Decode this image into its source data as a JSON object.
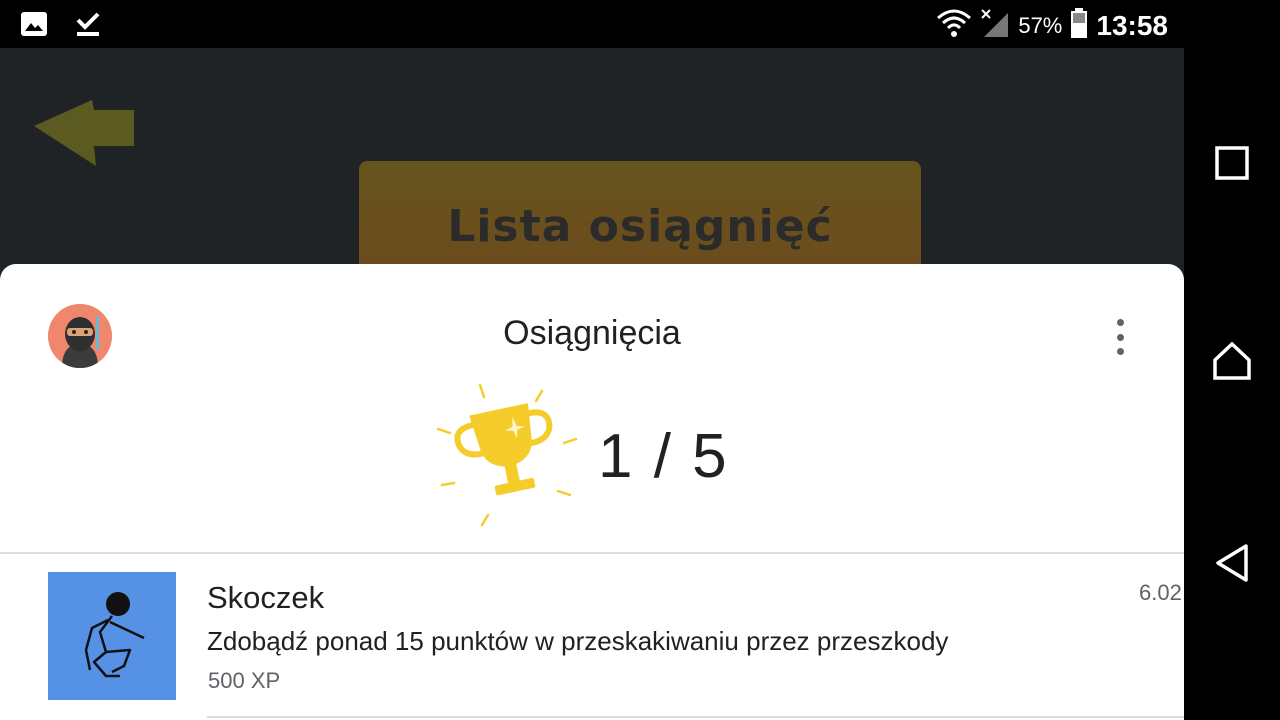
{
  "status_bar": {
    "icons_left": [
      "image-icon",
      "download-done-icon"
    ],
    "icons_right": [
      "wifi-icon",
      "signal-off-icon",
      "battery-icon"
    ],
    "battery_percent": "57%",
    "time": "13:58"
  },
  "navigation_bar": {
    "buttons": [
      "recents-icon",
      "home-icon",
      "back-icon"
    ]
  },
  "game": {
    "title": "Lista osiągnięć",
    "back_icon": "back-arrow-icon"
  },
  "achievements_sheet": {
    "title": "Osiągnięcia",
    "progress": "1 / 5",
    "achievements": [
      {
        "name": "Skoczek",
        "description": "Zdobądź ponad 15 punktów w przeskakiwaniu przez przeszkody",
        "xp": "500 XP",
        "date": "6.02"
      }
    ]
  },
  "colors": {
    "sheet_bg": "#ffffff",
    "game_bg": "#202326",
    "title_button": "#66541e",
    "trophy": "#f5cd2a",
    "achievement_thumb": "#5591e4"
  }
}
